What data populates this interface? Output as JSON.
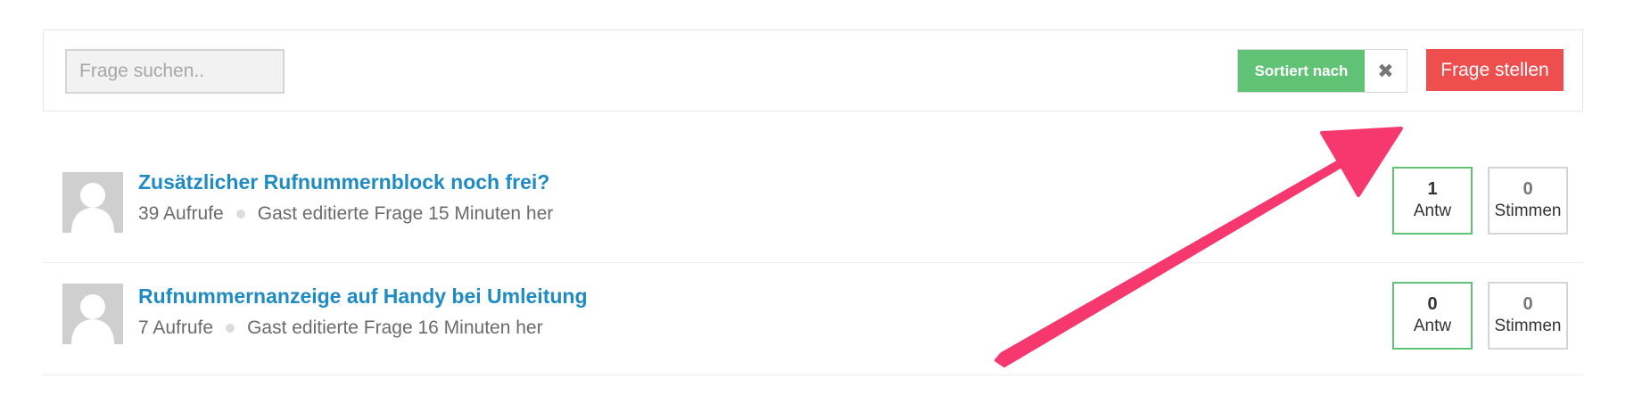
{
  "toolbar": {
    "search_placeholder": "Frage suchen..",
    "sort_label": "Sortiert nach",
    "clear_sort_glyph": "✖",
    "ask_label": "Frage stellen"
  },
  "questions": [
    {
      "title": "Zusätzlicher Rufnummernblock noch frei?",
      "views": "39 Aufrufe",
      "activity": "Gast editierte Frage 15 Minuten her",
      "answers_count": "1",
      "answers_label": "Antw",
      "votes_count": "0",
      "votes_label": "Stimmen"
    },
    {
      "title": "Rufnummernanzeige auf Handy bei Umleitung",
      "views": "7 Aufrufe",
      "activity": "Gast editierte Frage 16 Minuten her",
      "answers_count": "0",
      "answers_label": "Antw",
      "votes_count": "0",
      "votes_label": "Stimmen"
    }
  ],
  "icons": {
    "avatar": "default-user-avatar-icon",
    "clear_sort": "close-icon",
    "meta_separator": "dot-icon"
  },
  "colors": {
    "link": "#1f8bc3",
    "sort_button": "#5fc275",
    "ask_button": "#ef4e4e",
    "answers_border": "#5fc275",
    "annotation_arrow": "#f7386e"
  }
}
